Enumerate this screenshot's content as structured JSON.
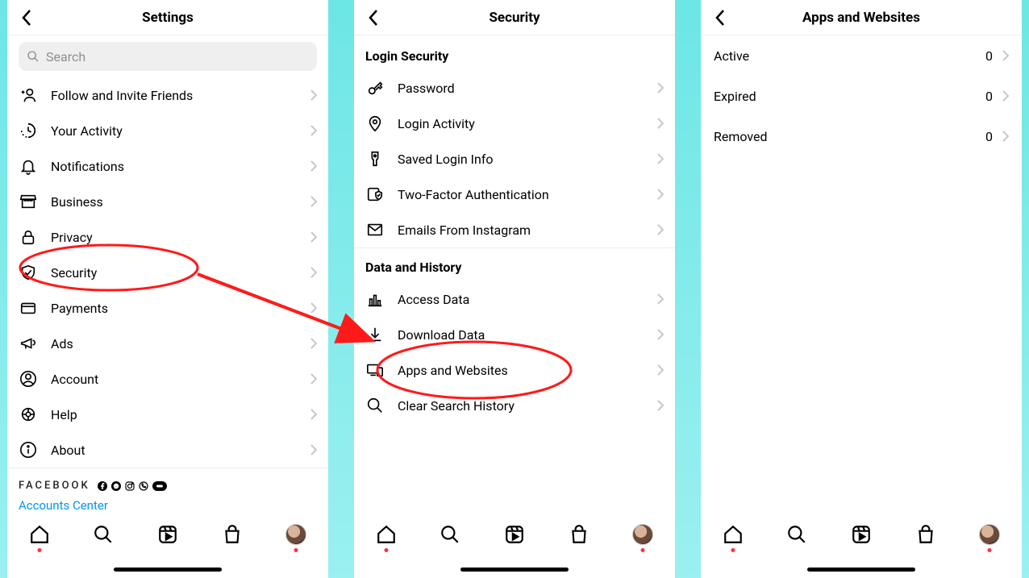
{
  "screens": {
    "settings": {
      "title": "Settings",
      "search_placeholder": "Search",
      "items": [
        {
          "label": "Follow and Invite Friends"
        },
        {
          "label": "Your Activity"
        },
        {
          "label": "Notifications"
        },
        {
          "label": "Business"
        },
        {
          "label": "Privacy"
        },
        {
          "label": "Security"
        },
        {
          "label": "Payments"
        },
        {
          "label": "Ads"
        },
        {
          "label": "Account"
        },
        {
          "label": "Help"
        },
        {
          "label": "About"
        }
      ],
      "footer_brand": "FACEBOOK",
      "footer_link": "Accounts Center"
    },
    "security": {
      "title": "Security",
      "section1": "Login Security",
      "items1": [
        {
          "label": "Password"
        },
        {
          "label": "Login Activity"
        },
        {
          "label": "Saved Login Info"
        },
        {
          "label": "Two-Factor Authentication"
        },
        {
          "label": "Emails From Instagram"
        }
      ],
      "section2": "Data and History",
      "items2": [
        {
          "label": "Access Data"
        },
        {
          "label": "Download Data"
        },
        {
          "label": "Apps and Websites"
        },
        {
          "label": "Clear Search History"
        }
      ]
    },
    "apps": {
      "title": "Apps and Websites",
      "rows": [
        {
          "label": "Active",
          "count": "0"
        },
        {
          "label": "Expired",
          "count": "0"
        },
        {
          "label": "Removed",
          "count": "0"
        }
      ]
    }
  }
}
